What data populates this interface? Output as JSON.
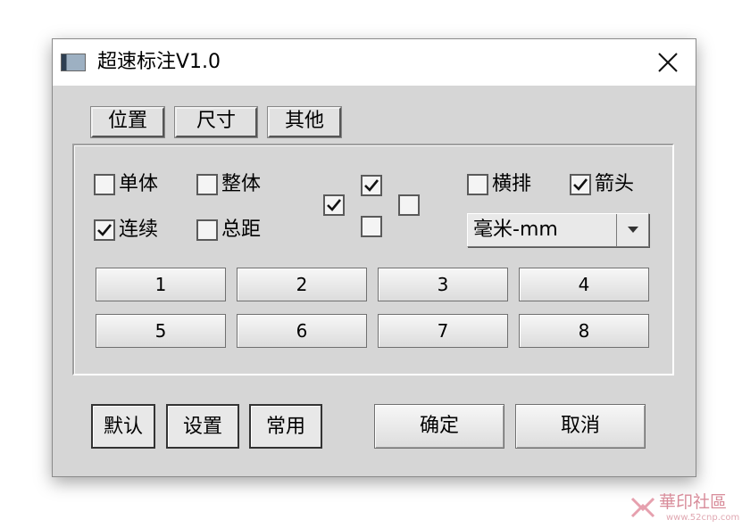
{
  "window": {
    "title": "超速标注V1.0"
  },
  "tabs": [
    {
      "label": "位置"
    },
    {
      "label": "尺寸"
    },
    {
      "label": "其他"
    }
  ],
  "options": {
    "single": {
      "label": "单体",
      "checked": false
    },
    "whole": {
      "label": "整体",
      "checked": false
    },
    "continuous": {
      "label": "连续",
      "checked": true
    },
    "total_distance": {
      "label": "总距",
      "checked": false
    },
    "horizontal": {
      "label": "横排",
      "checked": false
    },
    "arrow": {
      "label": "箭头",
      "checked": true
    },
    "position_grid": {
      "left": true,
      "top": true,
      "right": false,
      "bottom": false
    }
  },
  "unit_select": {
    "value": "毫米-mm"
  },
  "number_buttons": [
    "1",
    "2",
    "3",
    "4",
    "5",
    "6",
    "7",
    "8"
  ],
  "bottom_buttons": {
    "default": "默认",
    "settings": "设置",
    "common": "常用",
    "ok": "确定",
    "cancel": "取消"
  },
  "watermark": {
    "text": "華印社區",
    "sub": "www.52cnp.com"
  },
  "colors": {
    "window_bg": "#d6d6d6",
    "titlebar_bg": "#ffffff",
    "watermark": "#d88c9a"
  }
}
